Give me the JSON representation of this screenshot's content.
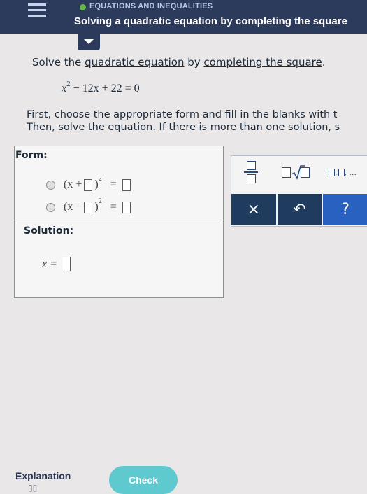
{
  "header": {
    "topic": "EQUATIONS AND INEQUALITIES",
    "title": "Solving a quadratic equation by completing the square"
  },
  "problem": {
    "prompt_start": "Solve the ",
    "prompt_link1": "quadratic equation",
    "prompt_mid": " by ",
    "prompt_link2": "completing the square",
    "prompt_end": ".",
    "equation_base": "x",
    "equation_exp": "2",
    "equation_rest": "− 12x + 22 = 0",
    "instructions_line1": "First, choose the appropriate form and fill in the blanks with t",
    "instructions_line2": "Then, solve the equation. If there is more than one solution, s"
  },
  "form": {
    "label": "Form:",
    "option1_open": "(x +",
    "option1_close": ")",
    "option1_exp": "2",
    "option1_eq": "=",
    "option2_open": "(x −",
    "option2_close": ")",
    "option2_exp": "2",
    "option2_eq": "="
  },
  "solution": {
    "label": "Solution:",
    "var": "x ="
  },
  "palette": {
    "list_label": ", ...",
    "clear": "×",
    "undo": "↶",
    "help": "?"
  },
  "footer": {
    "explanation": "Explanation",
    "check": "Check"
  }
}
